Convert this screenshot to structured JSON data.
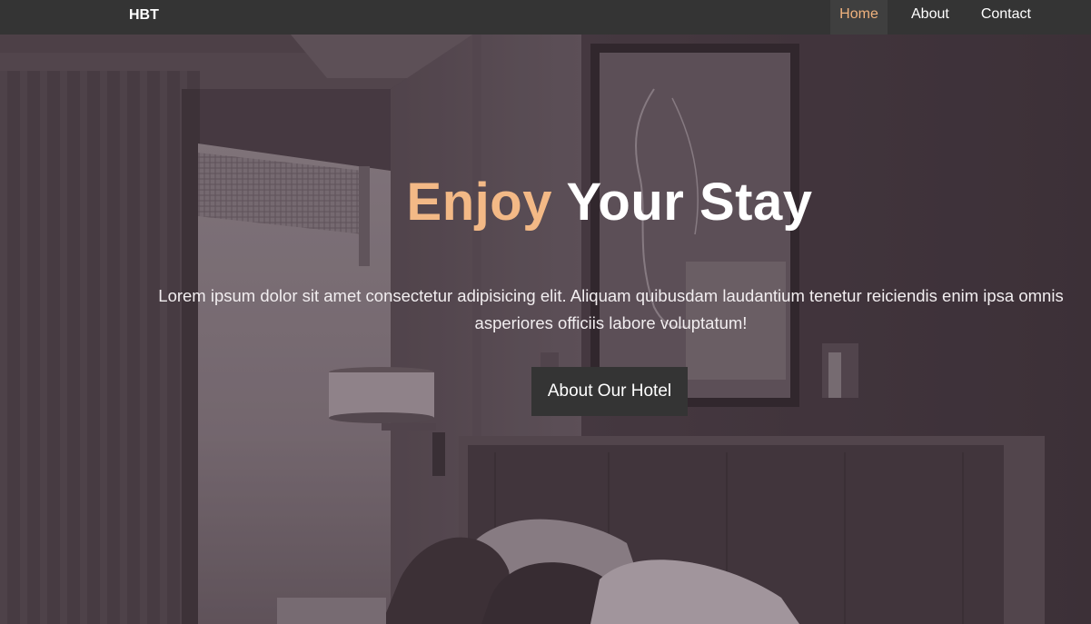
{
  "navbar": {
    "brand": "HBT",
    "links": [
      {
        "label": "Home",
        "active": true
      },
      {
        "label": "About",
        "active": false
      },
      {
        "label": "Contact",
        "active": false
      }
    ]
  },
  "hero": {
    "title_accent": "Enjoy",
    "title_rest": " Your Stay",
    "text": "Lorem ipsum dolor sit amet consectetur adipisicing elit. Aliquam quibusdam laudantium tenetur reiciendis enim ipsa omnis asperiores officiis labore voluptatum!",
    "button_label": "About Our Hotel"
  },
  "colors": {
    "navbar_bg": "#343434",
    "accent": "#f3b986",
    "active_nav": "#f0b27d",
    "button_bg": "#343434"
  }
}
